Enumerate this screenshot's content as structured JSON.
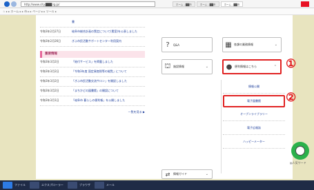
{
  "browser": {
    "address": "http://www.city.███.lg.jp/",
    "tabs": [
      "ホーム - ██市",
      "ホーム - ██市",
      "ホーム - ██市"
    ],
    "bookmarks": "☆ ▸ ▸ ホーム ▸ ▸ 市 ▸ ▸ ページ ▸ ▸ ツール ▸"
  },
  "news_top": [
    {
      "date": "",
      "text": "書"
    },
    {
      "date": "令和3年2月27日",
      "text": "岐阜市総合計画の策定について(素案)を公表しました"
    },
    {
      "date": "令和3年2月26日",
      "text": "ぎふ市民活動サポートセンター利用案内"
    }
  ],
  "important": {
    "heading": "重要情報",
    "items": [
      {
        "date": "令和3年3月2日",
        "text": "「給付サービス」を掲載しました"
      },
      {
        "date": "令和3年3月2日",
        "text": "「令和3年度 固定資産税等の縦覧」について"
      },
      {
        "date": "令和3年3月2日",
        "text": "「ぎふ市民活動交流サロン」を開設しました"
      },
      {
        "date": "令和3年3月2日",
        "text": "「まちかどの図書館」の開設について"
      },
      {
        "date": "令和3年3月1日",
        "text": "「岐阜市 暮らしの便利帳」を公開しました"
      }
    ],
    "more": "一覧を見る ▶"
  },
  "panel_buttons": {
    "faq": {
      "icon": "?",
      "label": "Q&A"
    },
    "admin": {
      "icon": "▦",
      "label": "各課の業務情報"
    },
    "facility": {
      "icon": "⛫",
      "label": "施設情報"
    },
    "useful": {
      "icon": "●",
      "label": "便利情報はこちら"
    },
    "bottom": {
      "icon": "⇄",
      "label": "情報ガイド"
    }
  },
  "links": [
    "情報公開",
    "電子図書館",
    "オープンライブラリー",
    "電子広報誌",
    "ハッピーメーター"
  ],
  "markers": {
    "one": "①",
    "two": "②"
  },
  "mascot_caption": "▤人気ワード",
  "taskbar": [
    "ファイル",
    "エクスプローラー",
    "ブラウザ",
    "メール"
  ],
  "colors": {
    "marker": "#e01b1b",
    "section": "#e6679a",
    "link": "#1b3c9a"
  }
}
